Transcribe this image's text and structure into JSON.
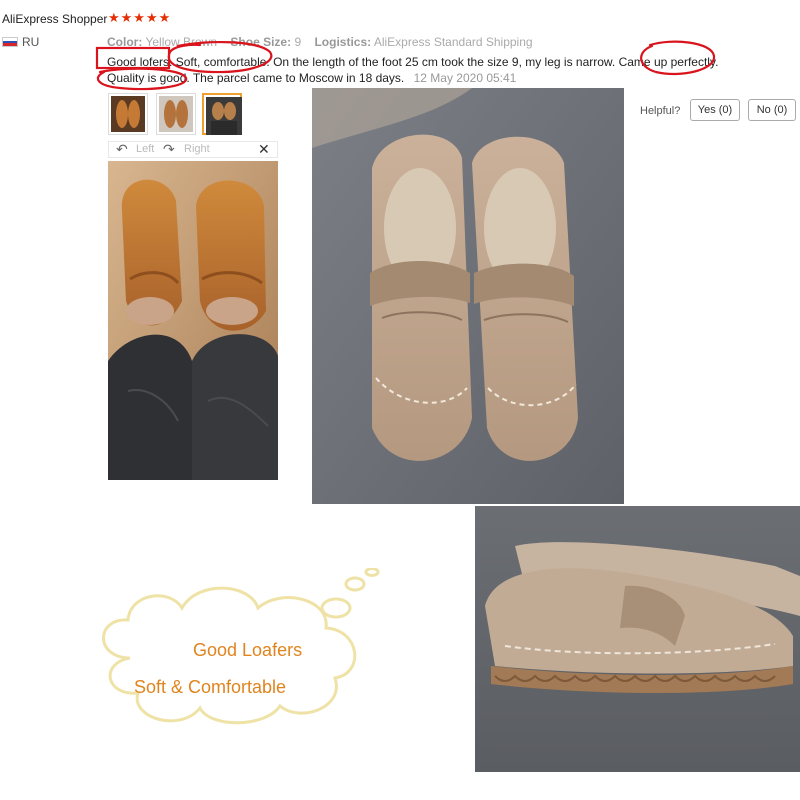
{
  "review": {
    "shopper_name": "AliExpress Shopper",
    "stars": "★★★★★",
    "country": "RU",
    "color_label": "Color:",
    "color_value": "Yellow Brown",
    "size_label": "Shoe Size:",
    "size_value": "9",
    "logistics_label": "Logistics:",
    "logistics_value": "AliExpress Standard Shipping",
    "text_line1": "Good lofers. Soft, comfortable. On the length of the foot 25 cm took the size 9, my leg is narrow. Came up perfectly.",
    "text_line2": "Quality is good. The parcel came to Moscow in 18 days.",
    "date": "12 May 2020 05:41"
  },
  "helpful": {
    "label": "Helpful?",
    "yes_label": "Yes (0)",
    "no_label": "No (0)"
  },
  "viewer": {
    "left_label": "Left",
    "right_label": "Right",
    "close_symbol": "✕",
    "active_thumbnail": 3
  },
  "cloud": {
    "line1": "Good Loafers",
    "line2": "Soft & Comfortable"
  },
  "colors": {
    "star": "#e62e04",
    "highlight_red": "#d9141d",
    "cloud_text": "#e0841e",
    "cloud_outline": "#efe2a6",
    "thumb_active": "#f0a030"
  }
}
